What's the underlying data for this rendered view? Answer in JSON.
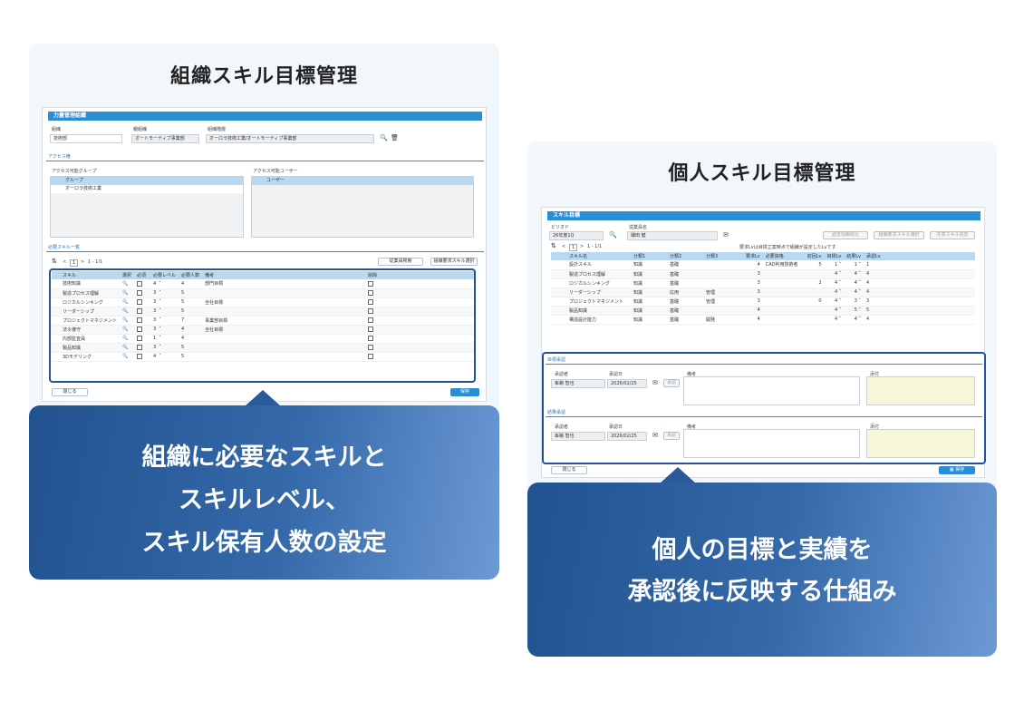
{
  "left": {
    "title": "組織スキル目標管理",
    "caption": [
      "組織に必要なスキルと",
      "スキルレベル、",
      "スキル保有人数の設定"
    ],
    "window_title": "力量管理組織",
    "fields": {
      "org_label": "組織",
      "org_value": "技術部",
      "parent_label": "親組織",
      "parent_value": "オートモーティブ事業部",
      "hierarchy_label": "組織階層",
      "hierarchy_value": "オーロラ技術工業/オートモーティブ事業部"
    },
    "access_section": "アクセス権",
    "access_group_label": "アクセス可能グループ",
    "access_group_header": "グループ",
    "access_group_row": "オーロラ技術工業",
    "access_user_label": "アクセス可能ユーザー",
    "access_user_header": "ユーザー",
    "skills_section": "必要スキル一覧",
    "pager": "1 - 1/1",
    "page_no": "1",
    "btn_search": "従業員検索",
    "btn_select": "組織要求スキル選択",
    "table_headers": [
      "スキル",
      "選択",
      "必須",
      "必要レベル",
      "必要人数",
      "備考",
      "削除"
    ],
    "rows": [
      {
        "skill": "技術知識",
        "level": "4",
        "count": "4",
        "note": "部門目標"
      },
      {
        "skill": "製造プロセス理解",
        "level": "3",
        "count": "5",
        "note": ""
      },
      {
        "skill": "ロジカルシンキング",
        "level": "3",
        "count": "5",
        "note": "全社目標"
      },
      {
        "skill": "リーダーシップ",
        "level": "3",
        "count": "5",
        "note": ""
      },
      {
        "skill": "プロジェクトマネジメント",
        "level": "3",
        "count": "7",
        "note": "事業部目標"
      },
      {
        "skill": "法令遵守",
        "level": "3",
        "count": "4",
        "note": "全社目標"
      },
      {
        "skill": "内部監査員",
        "level": "1",
        "count": "4",
        "note": ""
      },
      {
        "skill": "製品知識",
        "level": "3",
        "count": "5",
        "note": ""
      },
      {
        "skill": "3Dモデリング",
        "level": "4",
        "count": "5",
        "note": ""
      }
    ],
    "btn_close": "閉じる",
    "btn_save": "保存"
  },
  "right": {
    "title": "個人スキル目標管理",
    "caption": [
      "個人の目標と実績を",
      "承認後に反映する仕組み"
    ],
    "window_title": "スキル目標",
    "period_label": "ピリオド",
    "period_value": "26年度1Q",
    "employee_label": "従業員名",
    "employee_value": "磯田 健",
    "btn_prev": "過去情報取込",
    "btn_org": "組織要求スキル選択",
    "btn_add": "任意スキル追加",
    "pager": "1 - 1/1",
    "page_no": "1",
    "notice": "要求Lvは目標立案時点で組織が設定したLvです",
    "table_headers": [
      "スキル名",
      "分類1",
      "分類2",
      "分類3",
      "要求Lv",
      "必要資格",
      "前回Lv",
      "目標Lv",
      "結果Lv",
      "承認Lv"
    ],
    "rows": [
      {
        "skill": "設計スキル",
        "c1": "知識",
        "c2": "基礎",
        "c3": "",
        "req": "4",
        "qual": "CAD利用技術者",
        "prev": "5",
        "goal": "1",
        "res": "1",
        "appr": "1"
      },
      {
        "skill": "製造プロセス理解",
        "c1": "知識",
        "c2": "基礎",
        "c3": "",
        "req": "3",
        "qual": "",
        "prev": "",
        "goal": "4",
        "res": "4",
        "appr": "4"
      },
      {
        "skill": "ロジカルシンキング",
        "c1": "知識",
        "c2": "基礎",
        "c3": "",
        "req": "3",
        "qual": "",
        "prev": "2",
        "goal": "4",
        "res": "4",
        "appr": "4"
      },
      {
        "skill": "リーダーシップ",
        "c1": "知識",
        "c2": "応用",
        "c3": "管理",
        "req": "3",
        "qual": "",
        "prev": "",
        "goal": "4",
        "res": "4",
        "appr": "4"
      },
      {
        "skill": "プロジェクトマネジメント",
        "c1": "知識",
        "c2": "基礎",
        "c3": "管理",
        "req": "3",
        "qual": "",
        "prev": "0",
        "goal": "4",
        "res": "3",
        "appr": "3"
      },
      {
        "skill": "製品知識",
        "c1": "知識",
        "c2": "基礎",
        "c3": "",
        "req": "4",
        "qual": "",
        "prev": "",
        "goal": "4",
        "res": "5",
        "appr": "5"
      },
      {
        "skill": "構造設計能力",
        "c1": "知識",
        "c2": "基礎",
        "c3": "開発",
        "req": "4",
        "qual": "",
        "prev": "",
        "goal": "4",
        "res": "4",
        "appr": "4"
      }
    ],
    "goal_section": "目標承認",
    "result_section": "結果承認",
    "approver_label": "承認者",
    "date_label": "承認日",
    "note_label": "備考",
    "attach_label": "添付",
    "goal_approver": "峯嶋 智也",
    "goal_date": "2026/02/25",
    "result_approver": "峯嶋 智也",
    "result_date": "2026/02/25",
    "btn_approve": "承認",
    "btn_close": "閉じる",
    "btn_save": "保存"
  }
}
